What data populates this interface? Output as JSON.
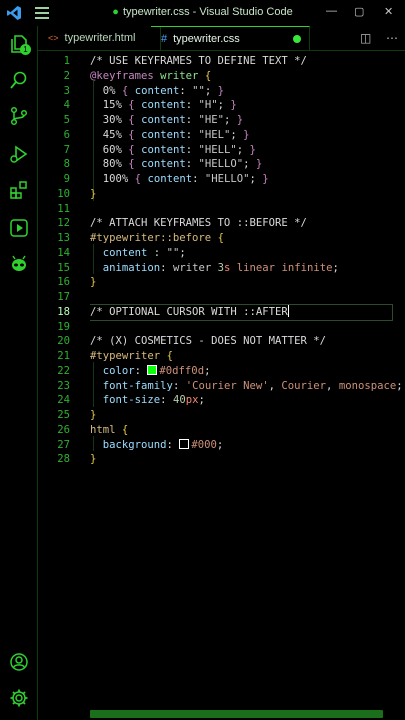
{
  "window": {
    "title": "typewriter.css - Visual Studio Code",
    "modified_marker": "●",
    "minimize": "—",
    "maximize": "▢",
    "close": "✕"
  },
  "tabs": [
    {
      "icon": "<>",
      "label": "typewriter.html"
    },
    {
      "icon": "#",
      "label": "typewriter.css"
    }
  ],
  "tab_tools": {
    "split": "◫",
    "more": "⋯"
  },
  "activity_badge": "1",
  "editor": {
    "current_line": 18,
    "lines": [
      {
        "n": "1",
        "parts": [
          [
            "c-comment",
            "/* USE KEYFRAMES TO DEFINE TEXT */"
          ]
        ]
      },
      {
        "n": "2",
        "parts": [
          [
            "c-at",
            "@keyframes"
          ],
          [
            "c-punc",
            " "
          ],
          [
            "c-kw",
            "writer"
          ],
          [
            "c-punc",
            " "
          ],
          [
            "c-brace2",
            "{"
          ]
        ]
      },
      {
        "n": "3",
        "parts": [
          [
            "c-punc",
            "  "
          ],
          [
            "c-pct",
            "0%"
          ],
          [
            "c-punc",
            " "
          ],
          [
            "c-brace",
            "{"
          ],
          [
            "c-punc",
            " "
          ],
          [
            "c-prop",
            "content"
          ],
          [
            "c-punc",
            ": "
          ],
          [
            "c-str",
            "\"\""
          ],
          [
            "c-punc",
            "; "
          ],
          [
            "c-brace",
            "}"
          ]
        ]
      },
      {
        "n": "4",
        "parts": [
          [
            "c-punc",
            "  "
          ],
          [
            "c-pct",
            "15%"
          ],
          [
            "c-punc",
            " "
          ],
          [
            "c-brace",
            "{"
          ],
          [
            "c-punc",
            " "
          ],
          [
            "c-prop",
            "content"
          ],
          [
            "c-punc",
            ": "
          ],
          [
            "c-str",
            "\"H\""
          ],
          [
            "c-punc",
            "; "
          ],
          [
            "c-brace",
            "}"
          ]
        ]
      },
      {
        "n": "5",
        "parts": [
          [
            "c-punc",
            "  "
          ],
          [
            "c-pct",
            "30%"
          ],
          [
            "c-punc",
            " "
          ],
          [
            "c-brace",
            "{"
          ],
          [
            "c-punc",
            " "
          ],
          [
            "c-prop",
            "content"
          ],
          [
            "c-punc",
            ": "
          ],
          [
            "c-str",
            "\"HE\""
          ],
          [
            "c-punc",
            "; "
          ],
          [
            "c-brace",
            "}"
          ]
        ]
      },
      {
        "n": "6",
        "parts": [
          [
            "c-punc",
            "  "
          ],
          [
            "c-pct",
            "45%"
          ],
          [
            "c-punc",
            " "
          ],
          [
            "c-brace",
            "{"
          ],
          [
            "c-punc",
            " "
          ],
          [
            "c-prop",
            "content"
          ],
          [
            "c-punc",
            ": "
          ],
          [
            "c-str",
            "\"HEL\""
          ],
          [
            "c-punc",
            "; "
          ],
          [
            "c-brace",
            "}"
          ]
        ]
      },
      {
        "n": "7",
        "parts": [
          [
            "c-punc",
            "  "
          ],
          [
            "c-pct",
            "60%"
          ],
          [
            "c-punc",
            " "
          ],
          [
            "c-brace",
            "{"
          ],
          [
            "c-punc",
            " "
          ],
          [
            "c-prop",
            "content"
          ],
          [
            "c-punc",
            ": "
          ],
          [
            "c-str",
            "\"HELL\""
          ],
          [
            "c-punc",
            "; "
          ],
          [
            "c-brace",
            "}"
          ]
        ]
      },
      {
        "n": "8",
        "parts": [
          [
            "c-punc",
            "  "
          ],
          [
            "c-pct",
            "80%"
          ],
          [
            "c-punc",
            " "
          ],
          [
            "c-brace",
            "{"
          ],
          [
            "c-punc",
            " "
          ],
          [
            "c-prop",
            "content"
          ],
          [
            "c-punc",
            ": "
          ],
          [
            "c-str",
            "\"HELLO\""
          ],
          [
            "c-punc",
            "; "
          ],
          [
            "c-brace",
            "}"
          ]
        ]
      },
      {
        "n": "9",
        "parts": [
          [
            "c-punc",
            "  "
          ],
          [
            "c-pct",
            "100%"
          ],
          [
            "c-punc",
            " "
          ],
          [
            "c-brace",
            "{"
          ],
          [
            "c-punc",
            " "
          ],
          [
            "c-prop",
            "content"
          ],
          [
            "c-punc",
            ": "
          ],
          [
            "c-str",
            "\"HELLO\""
          ],
          [
            "c-punc",
            "; "
          ],
          [
            "c-brace",
            "}"
          ]
        ]
      },
      {
        "n": "10",
        "parts": [
          [
            "c-brace2",
            "}"
          ]
        ]
      },
      {
        "n": "11",
        "parts": []
      },
      {
        "n": "12",
        "parts": [
          [
            "c-comment",
            "/* ATTACH KEYFRAMES TO ::BEFORE */"
          ]
        ]
      },
      {
        "n": "13",
        "parts": [
          [
            "c-sel",
            "#typewriter::before"
          ],
          [
            "c-punc",
            " "
          ],
          [
            "c-brace2",
            "{"
          ]
        ]
      },
      {
        "n": "14",
        "parts": [
          [
            "c-punc",
            "  "
          ],
          [
            "c-prop",
            "content"
          ],
          [
            "c-punc",
            " : "
          ],
          [
            "c-str",
            "\"\""
          ],
          [
            "c-punc",
            ";"
          ]
        ]
      },
      {
        "n": "15",
        "parts": [
          [
            "c-punc",
            "  "
          ],
          [
            "c-prop",
            "animation"
          ],
          [
            "c-punc",
            ": "
          ],
          [
            "c-ident",
            "writer "
          ],
          [
            "c-num",
            "3"
          ],
          [
            "c-unit",
            "s"
          ],
          [
            "c-punc",
            " "
          ],
          [
            "c-val",
            "linear"
          ],
          [
            "c-punc",
            " "
          ],
          [
            "c-val",
            "infinite"
          ],
          [
            "c-punc",
            ";"
          ]
        ]
      },
      {
        "n": "16",
        "parts": [
          [
            "c-brace2",
            "}"
          ]
        ]
      },
      {
        "n": "17",
        "parts": []
      },
      {
        "n": "18",
        "parts": [
          [
            "c-comment",
            "/* OPTIONAL CURSOR WITH ::AFTER"
          ]
        ]
      },
      {
        "n": "19",
        "parts": []
      },
      {
        "n": "20",
        "parts": [
          [
            "c-comment",
            "/* (X) COSMETICS - DOES NOT MATTER */"
          ]
        ]
      },
      {
        "n": "21",
        "parts": [
          [
            "c-sel",
            "#typewriter"
          ],
          [
            "c-punc",
            " "
          ],
          [
            "c-brace2",
            "{"
          ]
        ]
      },
      {
        "n": "22",
        "parts": [
          [
            "c-punc",
            "  "
          ],
          [
            "c-prop",
            "color"
          ],
          [
            "c-punc",
            ": "
          ],
          [
            "swatch-green",
            ""
          ],
          [
            "c-val",
            "#0dff0d"
          ],
          [
            "c-punc",
            ";"
          ]
        ]
      },
      {
        "n": "23",
        "parts": [
          [
            "c-punc",
            "  "
          ],
          [
            "c-prop",
            "font-family"
          ],
          [
            "c-punc",
            ": "
          ],
          [
            "c-val",
            "'Courier New'"
          ],
          [
            "c-punc",
            ", "
          ],
          [
            "c-val",
            "Courier"
          ],
          [
            "c-punc",
            ", "
          ],
          [
            "c-val",
            "monospace"
          ],
          [
            "c-punc",
            ";"
          ]
        ]
      },
      {
        "n": "24",
        "parts": [
          [
            "c-punc",
            "  "
          ],
          [
            "c-prop",
            "font-size"
          ],
          [
            "c-punc",
            ": "
          ],
          [
            "c-num",
            "40"
          ],
          [
            "c-unit",
            "px"
          ],
          [
            "c-punc",
            ";"
          ]
        ]
      },
      {
        "n": "25",
        "parts": [
          [
            "c-brace2",
            "}"
          ]
        ]
      },
      {
        "n": "26",
        "parts": [
          [
            "c-sel",
            "html"
          ],
          [
            "c-punc",
            " "
          ],
          [
            "c-brace2",
            "{"
          ]
        ]
      },
      {
        "n": "27",
        "parts": [
          [
            "c-punc",
            "  "
          ],
          [
            "c-prop",
            "background"
          ],
          [
            "c-punc",
            ": "
          ],
          [
            "swatch-black",
            ""
          ],
          [
            "c-val",
            "#000"
          ],
          [
            "c-punc",
            ";"
          ]
        ]
      },
      {
        "n": "28",
        "parts": [
          [
            "c-brace2",
            "}"
          ]
        ]
      }
    ]
  },
  "colors": {
    "accent": "#2fd12f",
    "background": "#000000",
    "line_number": "#2fb02f"
  }
}
